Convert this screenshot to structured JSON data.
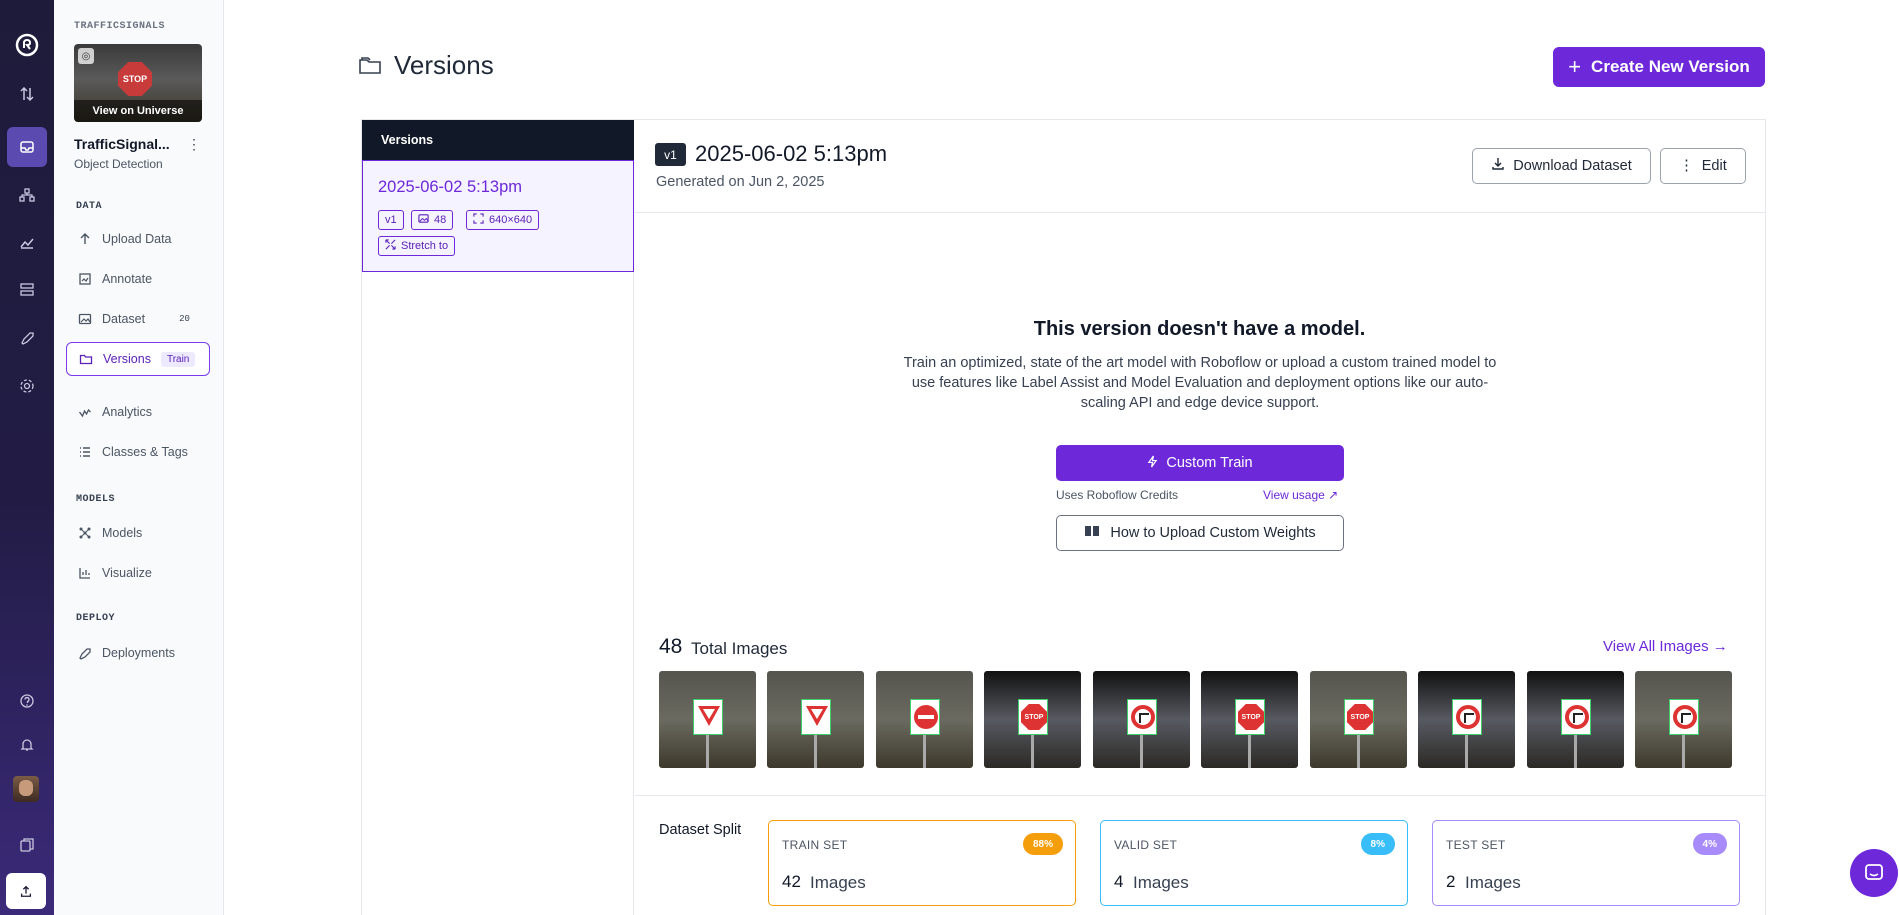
{
  "rail": {
    "icons": [
      "roboflow-logo-icon",
      "transfer-icon",
      "dataset-icon",
      "workflow-icon",
      "chart-icon",
      "stack-icon",
      "rocket-icon",
      "settings-icon",
      "help-icon",
      "bell-icon",
      "avatar",
      "docs-icon",
      "upload-icon"
    ]
  },
  "project": {
    "caption": "TRAFFICSIGNALS",
    "thumb_caption": "View on Universe",
    "thumb_sign_text": "STOP",
    "name": "TrafficSignal...",
    "type": "Object Detection"
  },
  "sidebar": {
    "data_title": "DATA",
    "models_title": "MODELS",
    "deploy_title": "DEPLOY",
    "upload": "Upload Data",
    "annotate": "Annotate",
    "dataset": "Dataset",
    "dataset_badge": "20",
    "versions": "Versions",
    "versions_badge": "Train",
    "analytics": "Analytics",
    "classes": "Classes & Tags",
    "models": "Models",
    "visualize": "Visualize",
    "deployments": "Deployments"
  },
  "header": {
    "title": "Versions",
    "create_button": "Create New Version"
  },
  "version_list": {
    "header": "Versions",
    "items": [
      {
        "date": "2025-06-02 5:13pm",
        "version": "v1",
        "images": "48",
        "size": "640×640",
        "resize": "Stretch to"
      }
    ]
  },
  "detail": {
    "badge": "v1",
    "title": "2025-06-02 5:13pm",
    "subtitle": "Generated on Jun 2, 2025",
    "download_button": "Download Dataset",
    "edit_button": "Edit"
  },
  "no_model": {
    "title": "This version doesn't have a model.",
    "description": "Train an optimized, state of the art model with Roboflow or upload a custom trained model to use features like Label Assist and Model Evaluation and deployment options like our auto-scaling API and edge device support.",
    "train_button": "Custom Train",
    "credits_note": "Uses Roboflow Credits",
    "view_usage": "View usage ↗",
    "weights_button": "How to Upload Custom Weights"
  },
  "images": {
    "count": "48",
    "label": "Total Images",
    "view_all": "View All Images →",
    "thumbs": [
      "yield",
      "yield",
      "no-entry",
      "stop",
      "turn",
      "stop",
      "stop",
      "turn",
      "turn",
      "turn"
    ]
  },
  "split": {
    "label": "Dataset Split",
    "cards": [
      {
        "title": "TRAIN SET",
        "pct": "88%",
        "count": "42",
        "unit": "Images",
        "color": "#f59e0b"
      },
      {
        "title": "VALID SET",
        "pct": "8%",
        "count": "4",
        "unit": "Images",
        "color": "#38bdf8"
      },
      {
        "title": "TEST SET",
        "pct": "4%",
        "count": "2",
        "unit": "Images",
        "color": "#a78bfa"
      }
    ]
  },
  "colors": {
    "accent": "#6d28d9",
    "rail": "#1e1b3a"
  }
}
